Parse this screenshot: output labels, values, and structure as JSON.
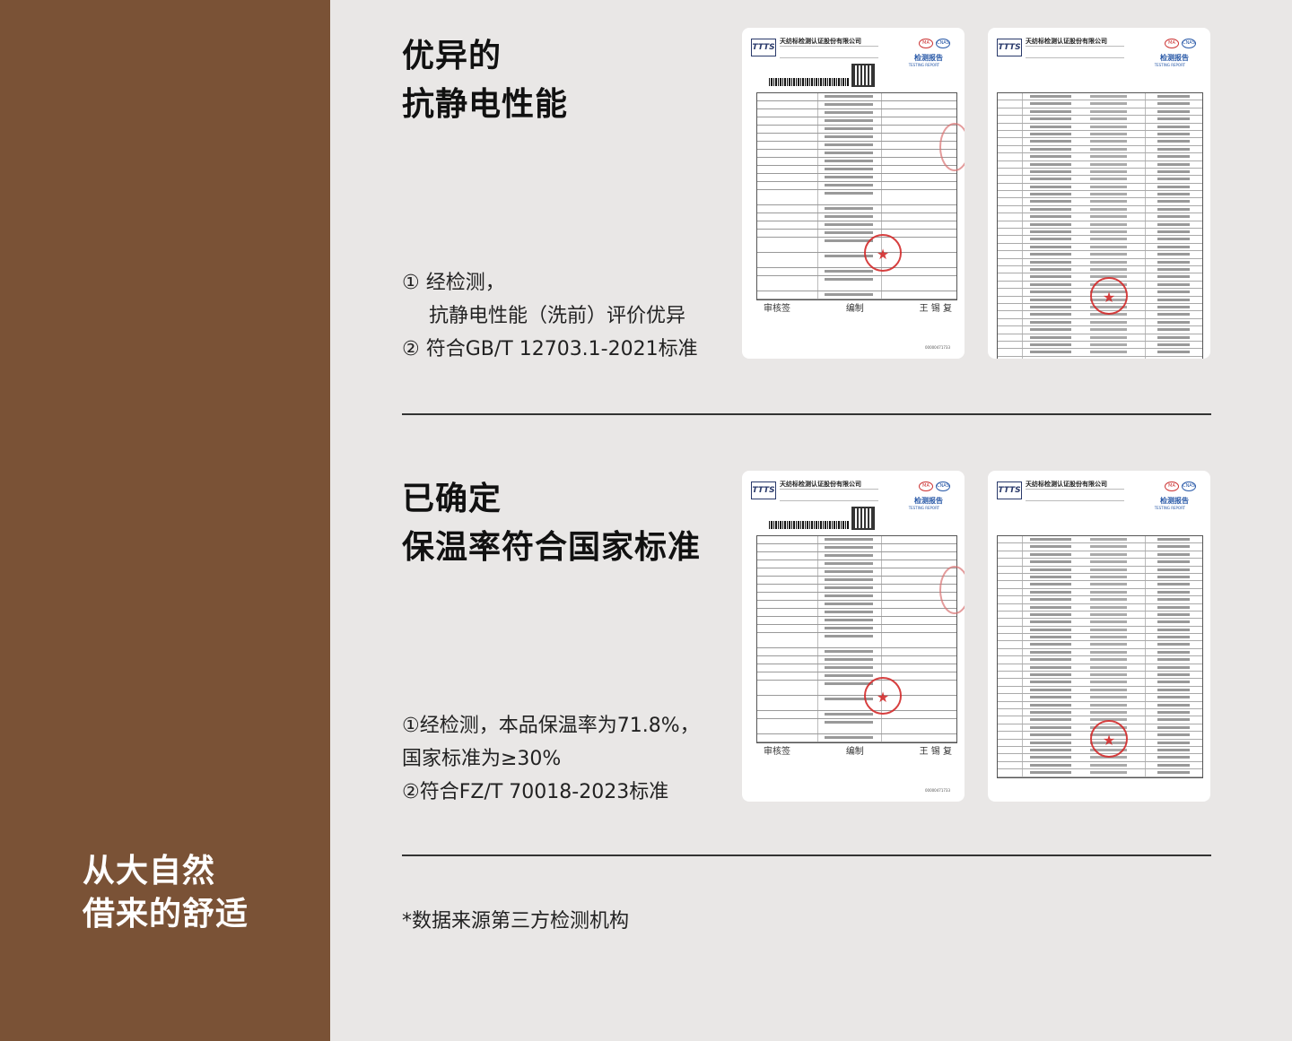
{
  "sidebar": {
    "slogan_line1": "从大自然",
    "slogan_line2": "借来的舒适"
  },
  "section1": {
    "title_line1": "优异的",
    "title_line2": "抗静电性能",
    "desc_line1": "① 经检测，",
    "desc_line2": "抗静电性能（洗前）评价优异",
    "desc_line3": "② 符合GB/T 12703.1-2021标准"
  },
  "section2": {
    "title_line1": "已确定",
    "title_line2": "保温率符合国家标准",
    "desc_line1": "①经检测，本品保温率为71.8%，",
    "desc_line2": "国家标准为≥30%",
    "desc_line3": "②符合FZ/T 70018-2023标准"
  },
  "report": {
    "logo": "TTTS",
    "company": "天纺标检测认证股份有限公司",
    "title": "检测报告",
    "title_en": "TESTING REPORT",
    "mark_a": "MA",
    "mark_b": "CNAS",
    "seal_symbol": "★",
    "signature_1": "审核签",
    "signature_2": "编制",
    "signature_3": "王 锡 复",
    "footer": "00000471733"
  },
  "note": "*数据来源第三方检测机构",
  "colors": {
    "sidebar": "#7a5236",
    "background": "#e9e7e6",
    "seal": "#d32b2b"
  }
}
